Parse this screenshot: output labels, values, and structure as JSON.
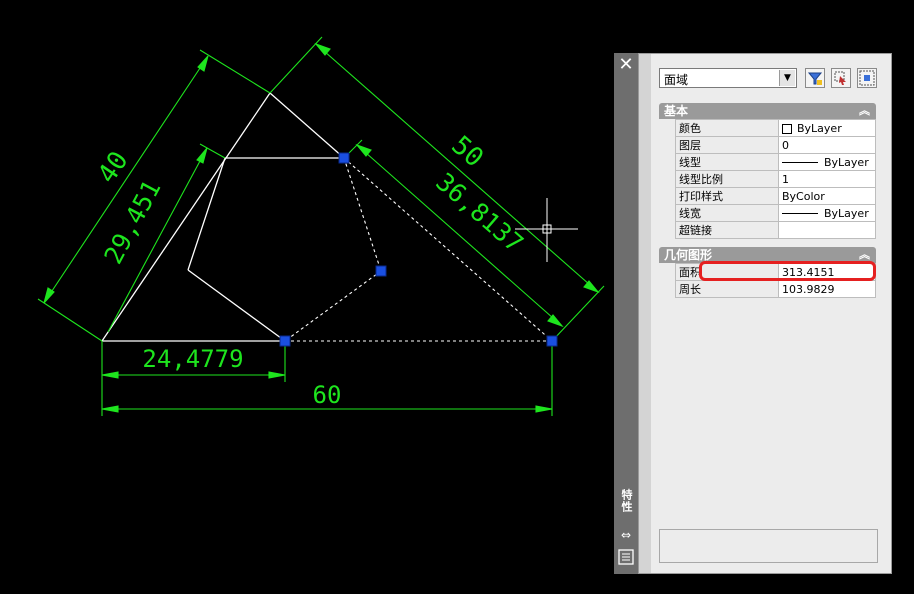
{
  "drawing": {
    "dimensions": {
      "d40": "40",
      "d29": "29,451",
      "d50": "50",
      "d36": "36,8137",
      "d24": "24,4779",
      "d60": "60"
    },
    "colors": {
      "background": "#000000",
      "geometry": "#ffffff",
      "dimension": "#1ee51e",
      "grip": "#1a4fe0"
    }
  },
  "palette": {
    "title": "特性",
    "object_type": "面域",
    "sections": [
      {
        "title": "基本",
        "rows": [
          {
            "name": "颜色",
            "value": "ByLayer",
            "swatch": "color-box"
          },
          {
            "name": "图层",
            "value": "0"
          },
          {
            "name": "线型",
            "value": "ByLayer",
            "swatch": "line"
          },
          {
            "name": "线型比例",
            "value": "1"
          },
          {
            "name": "打印样式",
            "value": "ByColor"
          },
          {
            "name": "线宽",
            "value": "ByLayer",
            "swatch": "line"
          },
          {
            "name": "超链接",
            "value": ""
          }
        ]
      },
      {
        "title": "几何图形",
        "rows": [
          {
            "name": "面积",
            "value": "313.4151"
          },
          {
            "name": "周长",
            "value": "103.9829"
          }
        ]
      }
    ]
  }
}
